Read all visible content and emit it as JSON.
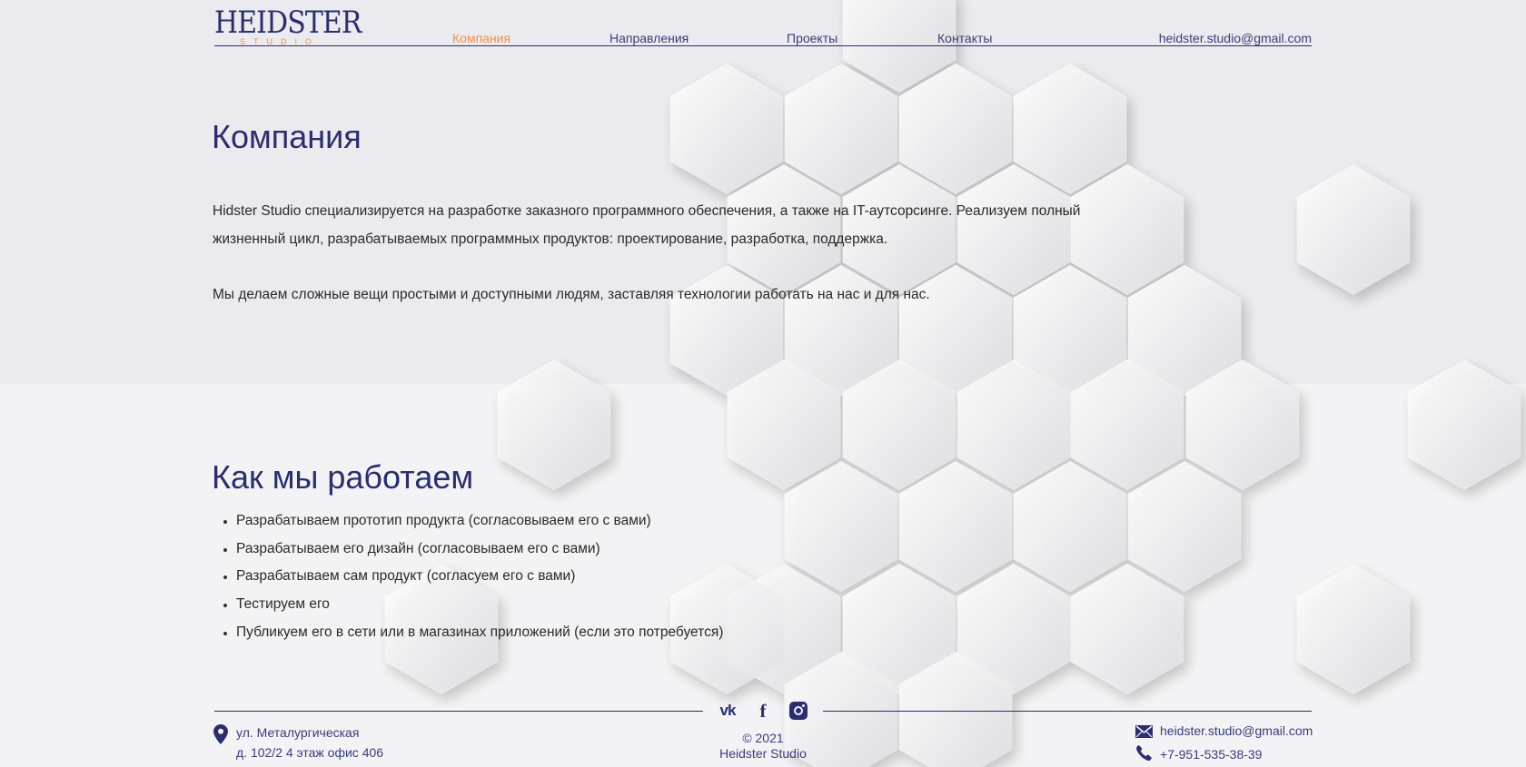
{
  "header": {
    "logo": {
      "main": "HEIDSTER",
      "sub": "STUDIO"
    },
    "nav": [
      {
        "label": "Компания",
        "active": true
      },
      {
        "label": "Направления",
        "active": false
      },
      {
        "label": "Проекты",
        "active": false
      },
      {
        "label": "Контакты",
        "active": false
      }
    ],
    "email": "heidster.studio@gmail.com"
  },
  "company": {
    "title": "Компания",
    "paragraph1": "Hidster Studio специализируется на разработке заказного программного обеспечения, а также на IT-аутсорсинге. Реализуем полный жизненный цикл, разрабатываемых программных продуктов: проектирование, разработка, поддержка.",
    "paragraph2": "Мы делаем сложные вещи простыми и доступными людям, заставляя технологии работать на нас и для нас."
  },
  "process": {
    "title": "Как мы работаем",
    "steps": [
      "Разрабатываем прототип продукта (согласовываем его с вами)",
      "Разрабатываем его дизайн (согласовываем его с вами)",
      "Разрабатываем сам продукт (согласуем его с вами)",
      "Тестируем его",
      "Публикуем его в сети или в магазинах приложений (если это потребуется)"
    ]
  },
  "footer": {
    "social": [
      {
        "icon": "vk-icon",
        "glyph": "vk"
      },
      {
        "icon": "facebook-icon",
        "glyph": "f"
      },
      {
        "icon": "instagram-icon",
        "glyph": ""
      }
    ],
    "address_line1": "ул. Металургическая",
    "address_line2": "д. 102/2 4 этаж офис 406",
    "copyright_line1": "© 2021",
    "copyright_line2": "Heidster Studio",
    "email": "heidster.studio@gmail.com",
    "phone": "+7-951-535-38-39"
  },
  "colors": {
    "brand": "#2b2d6e",
    "accent": "#f0904a",
    "text": "#2a2a2a"
  }
}
